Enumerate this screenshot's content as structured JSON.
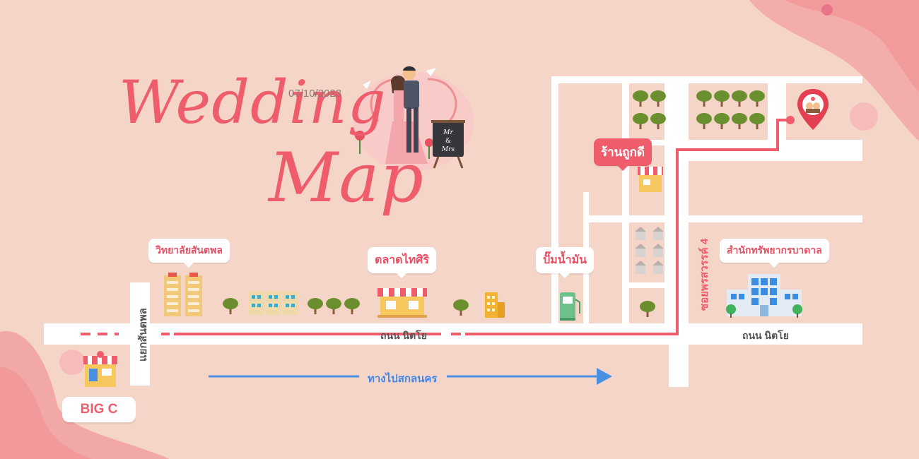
{
  "title": {
    "line1": "Wedding",
    "line2": "Map",
    "date": "07/10/2023"
  },
  "sign": {
    "top": "Mr",
    "mid": "&",
    "bottom": "Mrs"
  },
  "labels": {
    "college": "วิทยาลัยสันตพล",
    "market": "ตลาดไทศิริ",
    "gas_station": "ปั๊มน้ำมัน",
    "shop": "ร้านถูกดี",
    "land_office": "สำนักทรัพยากรบาดาล",
    "big_c": "BIG C"
  },
  "roads": {
    "main_left": "ถนน นิตโย",
    "main_right": "ถนน นิตโย",
    "junction": "แยกสันตพล",
    "soi": "ซอยพรสวรรค์ 4",
    "direction": "ทางไปสกลนคร"
  },
  "colors": {
    "background": "#f5d5c8",
    "road": "#ffffff",
    "route": "#ef5d6c",
    "title": "#ef5d6c",
    "direction_arrow": "#4a90e2",
    "tree": "#6b8f2e"
  },
  "icons": [
    "wedding-couple-illustration",
    "destination-pin-icon",
    "shop-icon",
    "market-icon",
    "building-icon",
    "gas-station-icon",
    "tree-icon",
    "office-building-icon",
    "house-icon",
    "big-c-store-icon"
  ]
}
